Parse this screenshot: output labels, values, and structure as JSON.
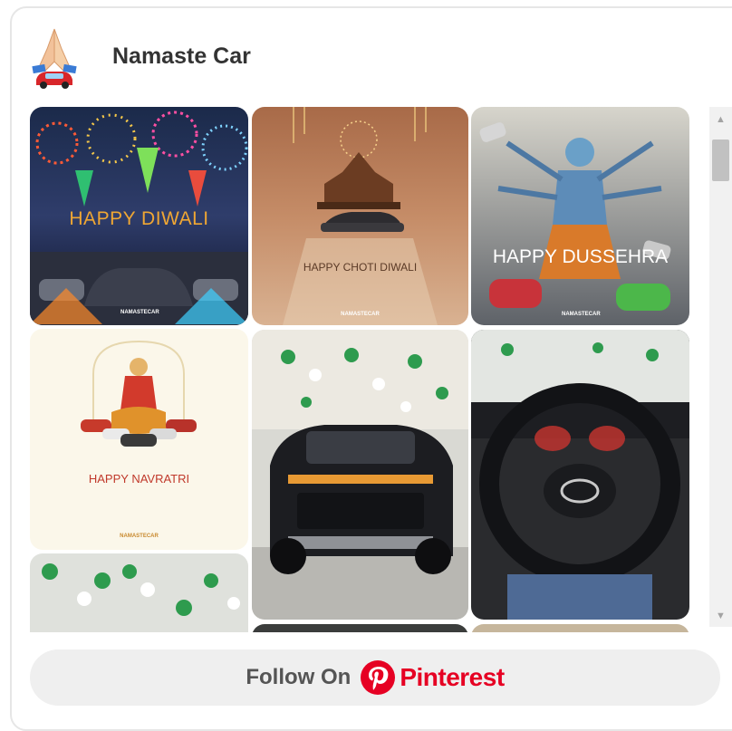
{
  "board": {
    "name": "Namaste Car",
    "avatar_icon": "folded-hands-car-logo"
  },
  "pins": [
    {
      "id": "pin-happy-diwali",
      "caption": "HAPPY DIWALI",
      "watermark": "NAMASTECAR"
    },
    {
      "id": "pin-happy-choti-diwali",
      "caption": "HAPPY CHOTI DIWALI",
      "watermark": "NAMASTECAR"
    },
    {
      "id": "pin-happy-dussehra",
      "caption": "HAPPY DUSSEHRA",
      "watermark": "NAMASTECAR"
    },
    {
      "id": "pin-happy-navratri",
      "caption": "HAPPY NAVRATRI",
      "watermark": "NAMASTECAR"
    },
    {
      "id": "pin-black-suv-showroom",
      "caption": ""
    },
    {
      "id": "pin-hyundai-steering",
      "caption": ""
    },
    {
      "id": "pin-showroom-balloons",
      "caption": ""
    }
  ],
  "follow": {
    "label": "Follow On",
    "brand": "Pinterest",
    "brand_icon": "pinterest-p-icon"
  },
  "colors": {
    "brand": "#e60023",
    "button_bg": "#efefef",
    "title": "#333333"
  }
}
